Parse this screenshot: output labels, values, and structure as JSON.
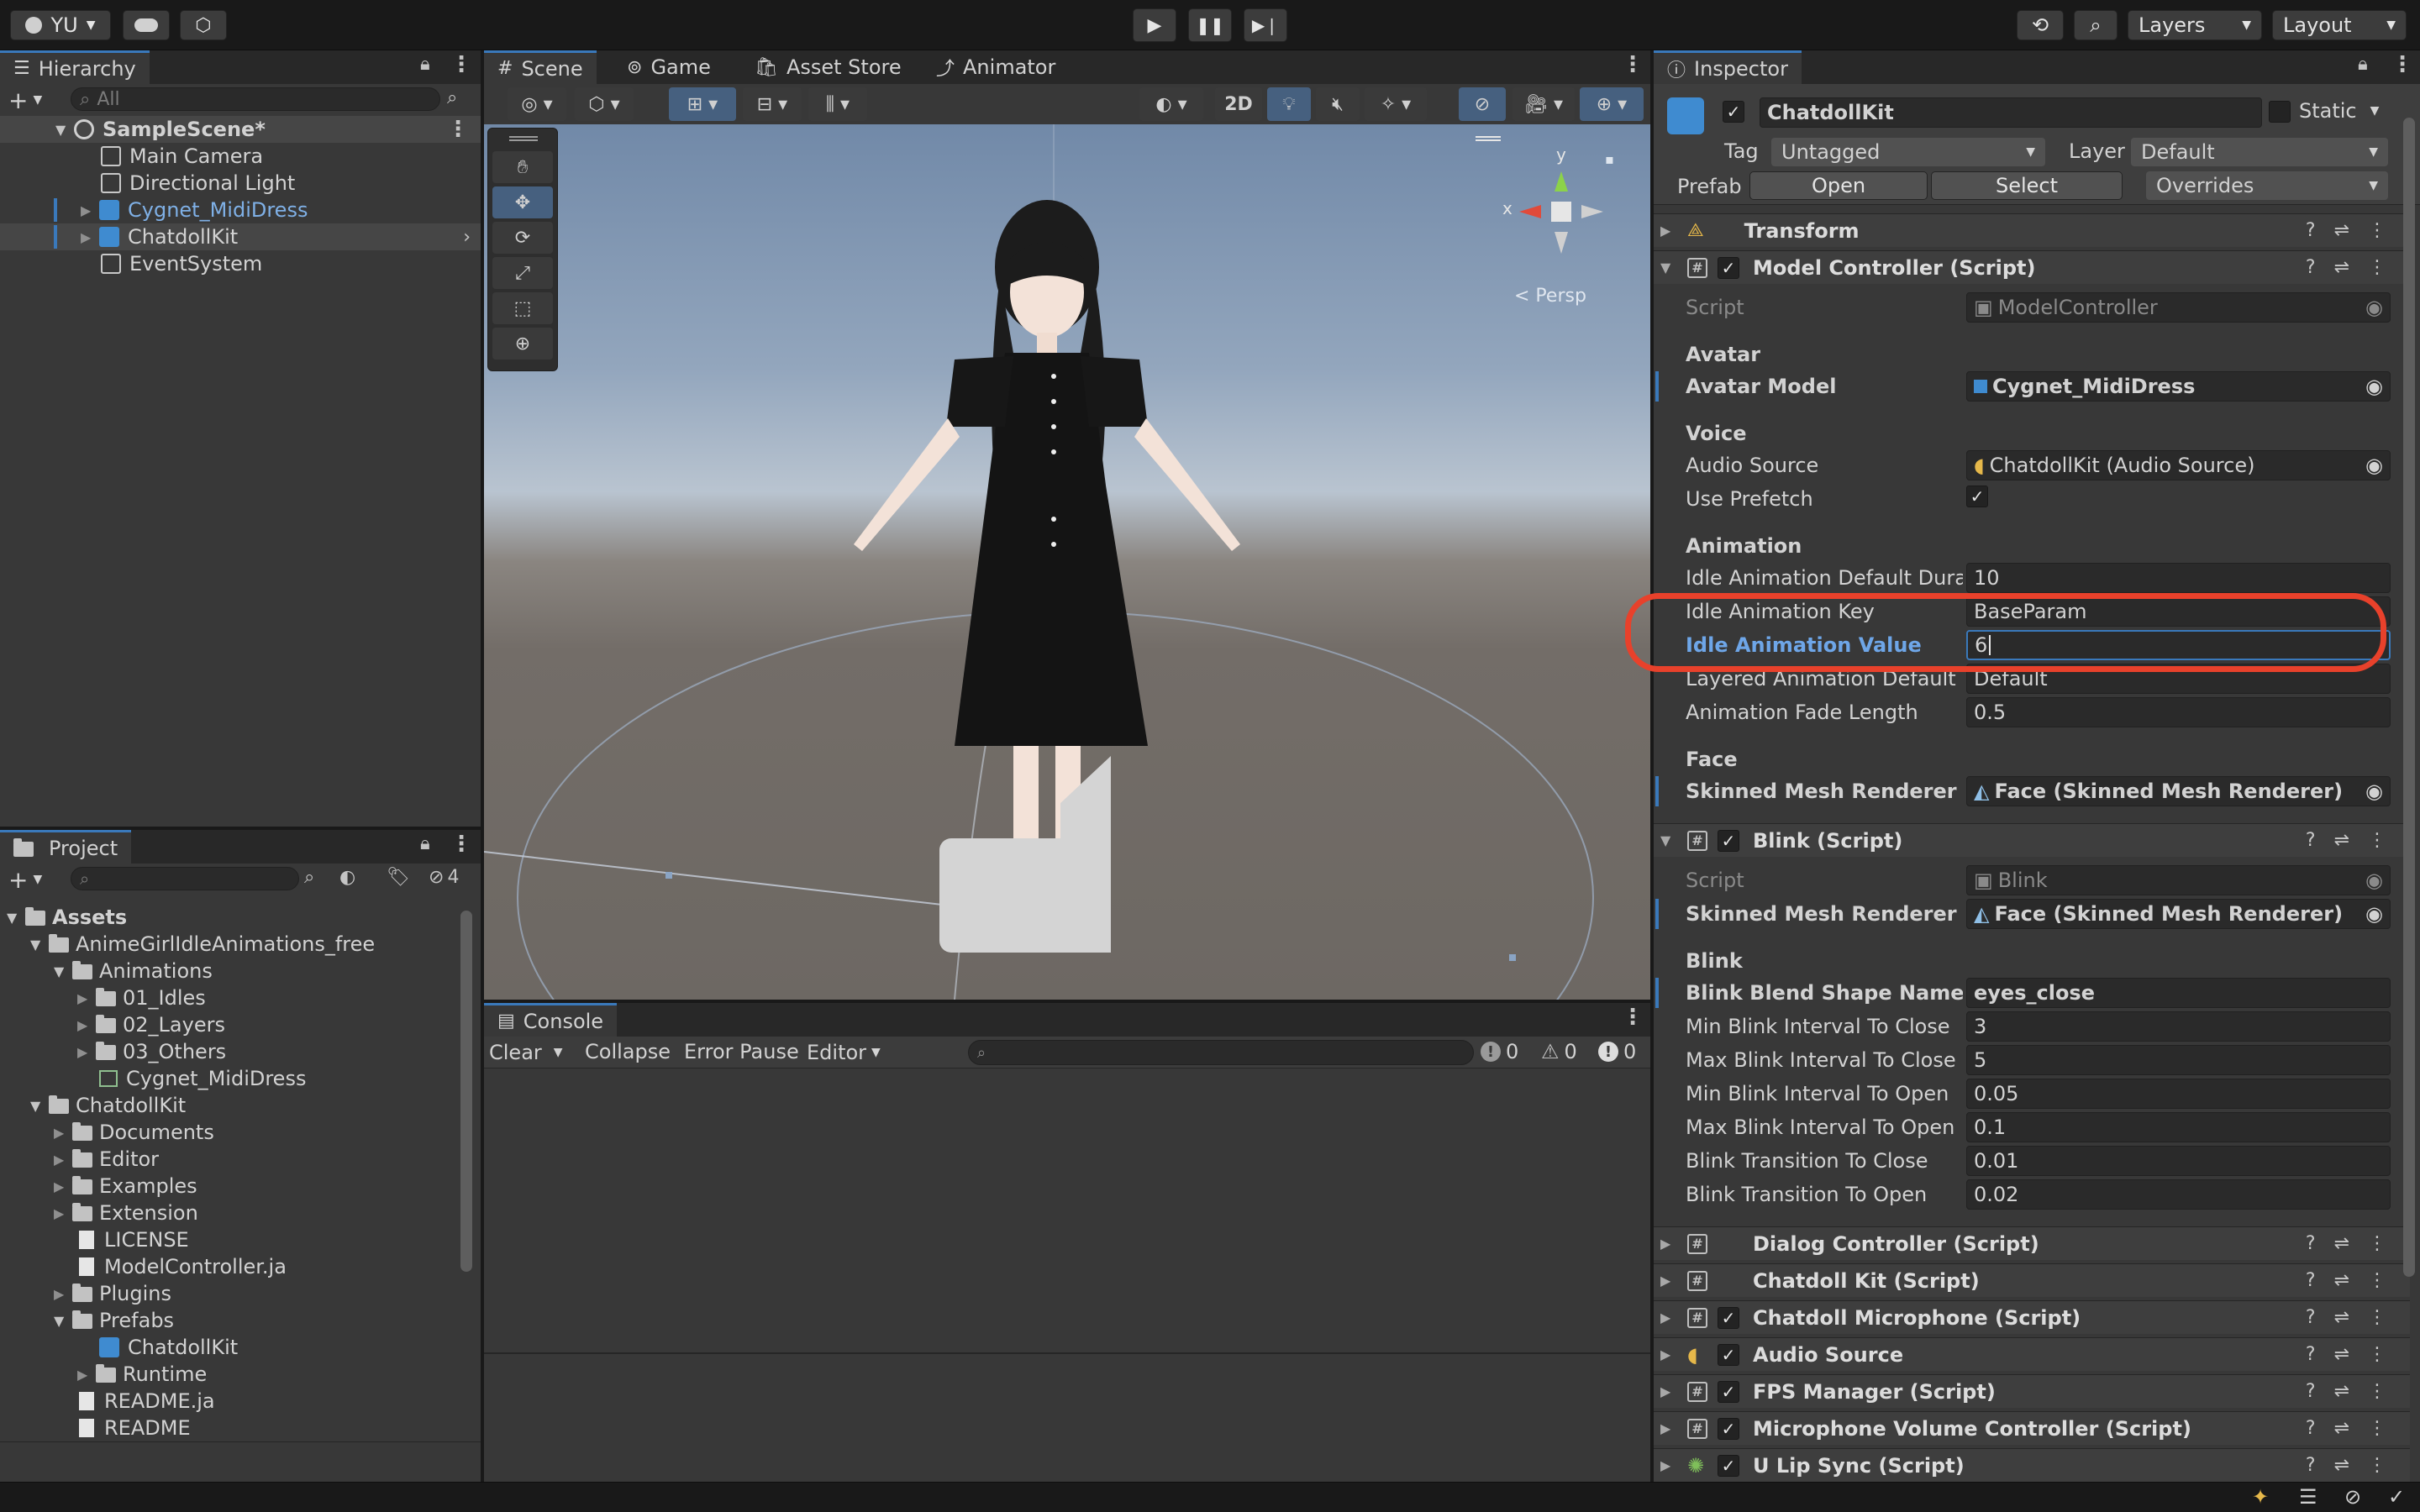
{
  "topbar": {
    "account": "YU",
    "layers": "Layers",
    "layout": "Layout"
  },
  "hierarchy": {
    "tab": "Hierarchy",
    "search_placeholder": "All",
    "scene": "SampleScene*",
    "items": [
      "Main Camera",
      "Directional Light",
      "Cygnet_MidiDress",
      "ChatdollKit",
      "EventSystem"
    ]
  },
  "scene_tabs": [
    "Scene",
    "Game",
    "Asset Store",
    "Animator"
  ],
  "scene_view": {
    "mode_2d": "2D",
    "persp": "< Persp",
    "axis_x": "x",
    "axis_y": "y"
  },
  "project": {
    "tab": "Project",
    "hidden_count": "4",
    "tree": [
      {
        "label": "Assets",
        "bold": true
      },
      {
        "label": "AnimeGirlIdleAnimations_free"
      },
      {
        "label": "Animations"
      },
      {
        "label": "01_Idles"
      },
      {
        "label": "02_Layers"
      },
      {
        "label": "03_Others"
      },
      {
        "label": "Cygnet_MidiDress"
      },
      {
        "label": "ChatdollKit"
      },
      {
        "label": "Documents"
      },
      {
        "label": "Editor"
      },
      {
        "label": "Examples"
      },
      {
        "label": "Extension"
      },
      {
        "label": "LICENSE"
      },
      {
        "label": "ModelController.ja"
      },
      {
        "label": "Plugins"
      },
      {
        "label": "Prefabs"
      },
      {
        "label": "ChatdollKit"
      },
      {
        "label": "Runtime"
      },
      {
        "label": "README.ja"
      },
      {
        "label": "README"
      }
    ]
  },
  "console": {
    "tab": "Console",
    "clear": "Clear",
    "collapse": "Collapse",
    "error_pause": "Error Pause",
    "editor": "Editor",
    "info_count": "0",
    "warn_count": "0",
    "error_count": "0"
  },
  "inspector": {
    "tab": "Inspector",
    "object_name": "ChatdollKit",
    "static": "Static",
    "tag_label": "Tag",
    "tag_value": "Untagged",
    "layer_label": "Layer",
    "layer_value": "Default",
    "prefab_label": "Prefab",
    "prefab_open": "Open",
    "prefab_select": "Select",
    "prefab_overrides": "Overrides",
    "transform": "Transform",
    "model_controller": {
      "title": "Model Controller (Script)",
      "script_label": "Script",
      "script_value": "ModelController",
      "avatar_header": "Avatar",
      "avatar_model_label": "Avatar Model",
      "avatar_model_value": "Cygnet_MidiDress",
      "voice_header": "Voice",
      "audio_source_label": "Audio Source",
      "audio_source_value": "ChatdollKit (Audio Source)",
      "use_prefetch_label": "Use Prefetch",
      "animation_header": "Animation",
      "idle_default_duration_label": "Idle Animation Default Duratic",
      "idle_default_duration_value": "10",
      "idle_key_label": "Idle Animation Key",
      "idle_key_value": "BaseParam",
      "idle_value_label": "Idle Animation Value",
      "idle_value_value": "6",
      "layered_default_label": "Layered Animation Default St",
      "layered_default_value": "Default",
      "fade_length_label": "Animation Fade Length",
      "fade_length_value": "0.5",
      "face_header": "Face",
      "smr_label": "Skinned Mesh Renderer",
      "smr_value": "Face (Skinned Mesh Renderer)"
    },
    "blink": {
      "title": "Blink (Script)",
      "script_label": "Script",
      "script_value": "Blink",
      "smr_label": "Skinned Mesh Renderer",
      "smr_value": "Face (Skinned Mesh Renderer)",
      "blink_header": "Blink",
      "shape_name_label": "Blink Blend Shape Name",
      "shape_name_value": "eyes_close",
      "min_close_label": "Min Blink Interval To Close",
      "min_close_value": "3",
      "max_close_label": "Max Blink Interval To Close",
      "max_close_value": "5",
      "min_open_label": "Min Blink Interval To Open",
      "min_open_value": "0.05",
      "max_open_label": "Max Blink Interval To Open",
      "max_open_value": "0.1",
      "trans_close_label": "Blink Transition To Close",
      "trans_close_value": "0.01",
      "trans_open_label": "Blink Transition To Open",
      "trans_open_value": "0.02"
    },
    "components": [
      "Dialog Controller (Script)",
      "Chatdoll Kit (Script)",
      "Chatdoll Microphone (Script)",
      "Audio Source",
      "FPS Manager (Script)",
      "Microphone Volume Controller (Script)",
      "U Lip Sync (Script)"
    ]
  },
  "colors": {
    "accent": "#3a79bb",
    "highlight_ring": "#e8412b",
    "scene_sky": "#a9b9cc",
    "scene_ground": "#6e6761"
  }
}
